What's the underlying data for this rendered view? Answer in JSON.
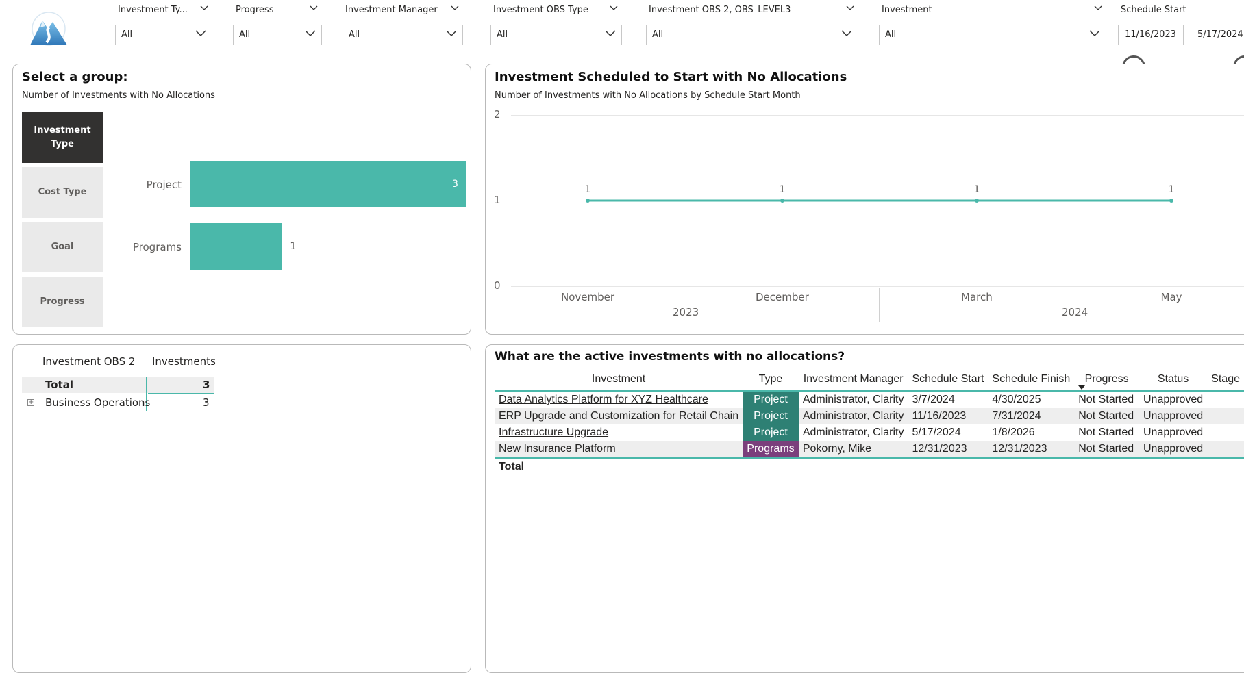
{
  "filters": [
    {
      "label": "Investment Ty...",
      "value": "All"
    },
    {
      "label": "Progress",
      "value": "All"
    },
    {
      "label": "Investment Manager",
      "value": "All"
    },
    {
      "label": "Investment OBS Type",
      "value": "All"
    },
    {
      "label": "Investment OBS 2, OBS_LEVEL3",
      "value": "All"
    },
    {
      "label": "Investment",
      "value": "All"
    }
  ],
  "schedule_start": {
    "label": "Schedule Start",
    "from": "11/16/2023",
    "to": "5/17/2024"
  },
  "group_panel": {
    "title": "Select a group:",
    "subtitle": "Number of Investments with No Allocations",
    "buttons": [
      "Investment Type",
      "Cost Type",
      "Goal",
      "Progress"
    ],
    "active_button": "Investment Type",
    "bars": [
      {
        "label": "Project",
        "value": 3,
        "display": "3"
      },
      {
        "label": "Programs",
        "value": 1,
        "display": "1"
      }
    ],
    "bar_max": 3
  },
  "line_panel": {
    "title": "Investment Scheduled to Start with No Allocations",
    "subtitle": "Number of Investments with No Allocations by Schedule Start Month",
    "y_ticks": [
      "2",
      "1",
      "0"
    ],
    "months": [
      "November",
      "December",
      "March",
      "May"
    ],
    "years": [
      "2023",
      "2024"
    ],
    "point_labels": [
      "1",
      "1",
      "1",
      "1"
    ]
  },
  "chart_data": {
    "type": "line",
    "x": [
      "November 2023",
      "December 2023",
      "March 2024",
      "May 2024"
    ],
    "series": [
      {
        "values": [
          1,
          1,
          1,
          1
        ]
      }
    ],
    "ylim": [
      0,
      2
    ]
  },
  "matrix": {
    "headers": [
      "Investment OBS 2",
      "Investments"
    ],
    "total_label": "Total",
    "total_value": "3",
    "rows": [
      {
        "label": "Business Operations",
        "value": "3"
      }
    ]
  },
  "table": {
    "title": "What are the active investments with no allocations?",
    "headers": [
      "Investment",
      "Type",
      "Investment Manager",
      "Schedule Start",
      "Schedule Finish",
      "Progress",
      "Status",
      "Stage"
    ],
    "rows": [
      {
        "investment": "Data Analytics Platform for XYZ Healthcare",
        "type": "Project",
        "manager": "Administrator, Clarity",
        "start": "3/7/2024",
        "finish": "4/30/2025",
        "progress": "Not Started",
        "status": "Unapproved",
        "stage": ""
      },
      {
        "investment": "ERP Upgrade and Customization for Retail Chain",
        "type": "Project",
        "manager": "Administrator, Clarity",
        "start": "11/16/2023",
        "finish": "7/31/2024",
        "progress": "Not Started",
        "status": "Unapproved",
        "stage": ""
      },
      {
        "investment": "Infrastructure Upgrade",
        "type": "Project",
        "manager": "Administrator, Clarity",
        "start": "5/17/2024",
        "finish": "1/8/2026",
        "progress": "Not Started",
        "status": "Unapproved",
        "stage": ""
      },
      {
        "investment": "New Insurance Platform",
        "type": "Programs",
        "manager": "Pokorny, Mike",
        "start": "12/31/2023",
        "finish": "12/31/2023",
        "progress": "Not Started",
        "status": "Unapproved",
        "stage": ""
      }
    ],
    "total_label": "Total"
  },
  "colors": {
    "accent": "#4ab8aa",
    "project_tag": "#2e8074",
    "programs_tag": "#7b3f7c",
    "active_button": "#323130"
  },
  "icons": {
    "logo": "mountain-logo-icon",
    "dropdown": "chevron-down-icon",
    "expand": "expand-plus-icon",
    "sort": "sort-desc-icon"
  }
}
